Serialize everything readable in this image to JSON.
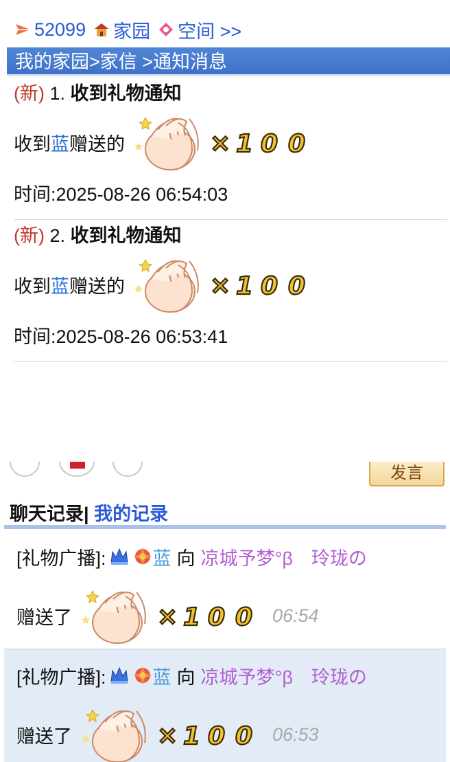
{
  "nav": {
    "count": "52099",
    "home_label": "家园",
    "space_label": "空间 >>"
  },
  "breadcrumb": "我的家园>家信 >通知消息",
  "notices": [
    {
      "new_tag": "(新)",
      "index": "1.",
      "title": "收到礼物通知",
      "prefix": "收到",
      "sender": "蓝",
      "suffix": "赠送的",
      "time": "时间:2025-08-26 06:54:03"
    },
    {
      "new_tag": "(新)",
      "index": "2.",
      "title": "收到礼物通知",
      "prefix": "收到",
      "sender": "蓝",
      "suffix": "赠送的",
      "time": "时间:2025-08-26 06:53:41"
    }
  ],
  "gift": {
    "icon": "clapping-hands-icon",
    "multiplier": "×100"
  },
  "chat": {
    "send_label": "发言",
    "tab_active": "聊天记录|",
    "tab_other": "我的记录",
    "messages": [
      {
        "tag": "[礼物广播]:",
        "sender": "蓝",
        "verb": "向",
        "target": "凉城予梦°β　玲珑の",
        "action": "赠送了",
        "time": "06:54"
      },
      {
        "tag": "[礼物广播]:",
        "sender": "蓝",
        "verb": "向",
        "target": "凉城予梦°β　玲珑の",
        "action": "赠送了",
        "time": "06:53"
      }
    ]
  },
  "colors": {
    "link": "#2a5bd7",
    "new_tag": "#c0392b",
    "breadcrumb_bg": "#4a7fd2",
    "target_name": "#b05fd0",
    "alt_row": "#e2ebf6"
  }
}
